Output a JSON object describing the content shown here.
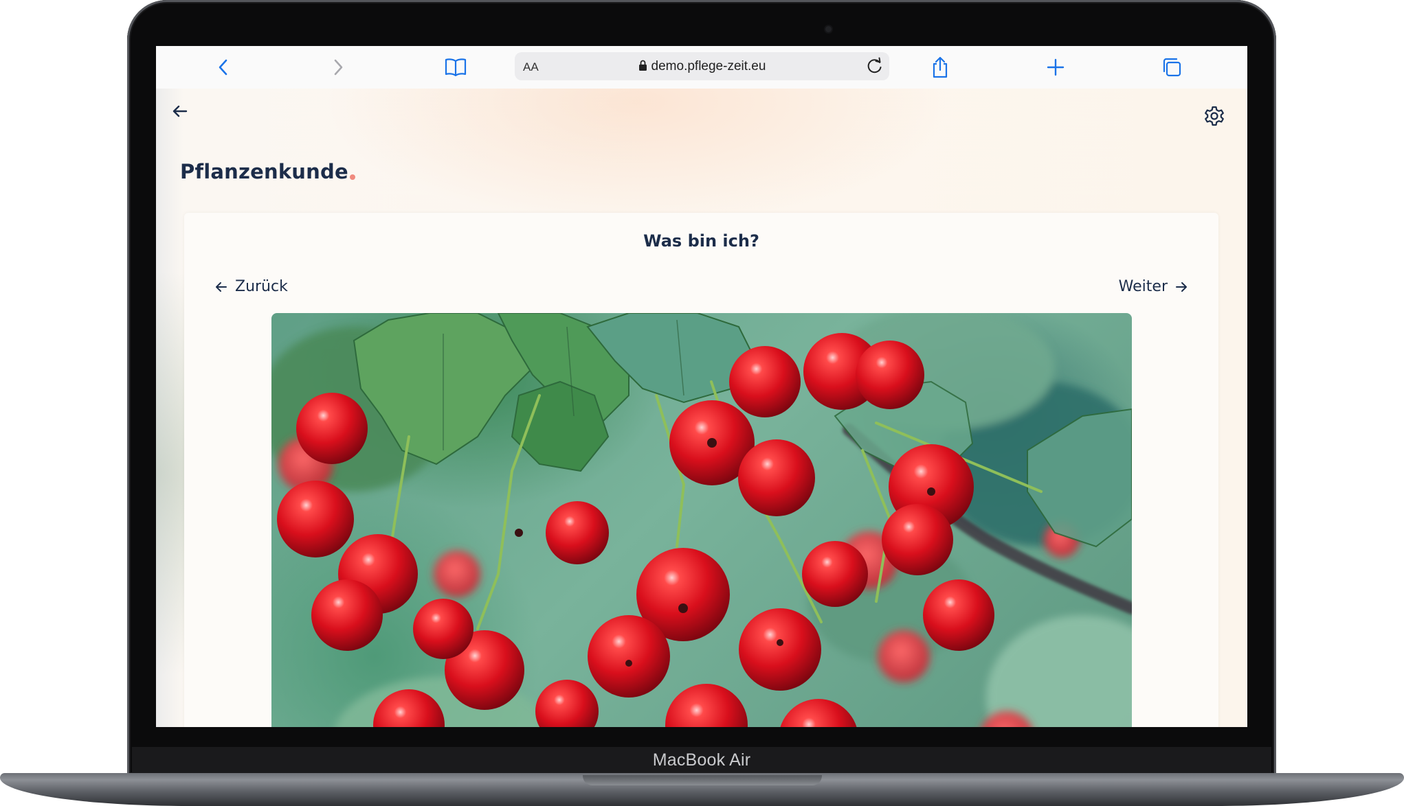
{
  "device": {
    "model_label": "MacBook Air"
  },
  "browser": {
    "url": "demo.pflege-zeit.eu",
    "reader_label": "AA",
    "icons": [
      "chevron-left-icon",
      "chevron-right-icon",
      "book-icon",
      "lock-icon",
      "reload-icon",
      "share-icon",
      "plus-icon",
      "tabs-icon"
    ]
  },
  "page": {
    "title": "Pflanzenkunde",
    "title_accent_color": "#f08a7e",
    "text_color": "#1c2d4a",
    "icons": [
      "arrow-left-icon",
      "gear-icon"
    ]
  },
  "quiz": {
    "question": "Was bin ich?",
    "prev_label": "Zurück",
    "next_label": "Weiter"
  }
}
